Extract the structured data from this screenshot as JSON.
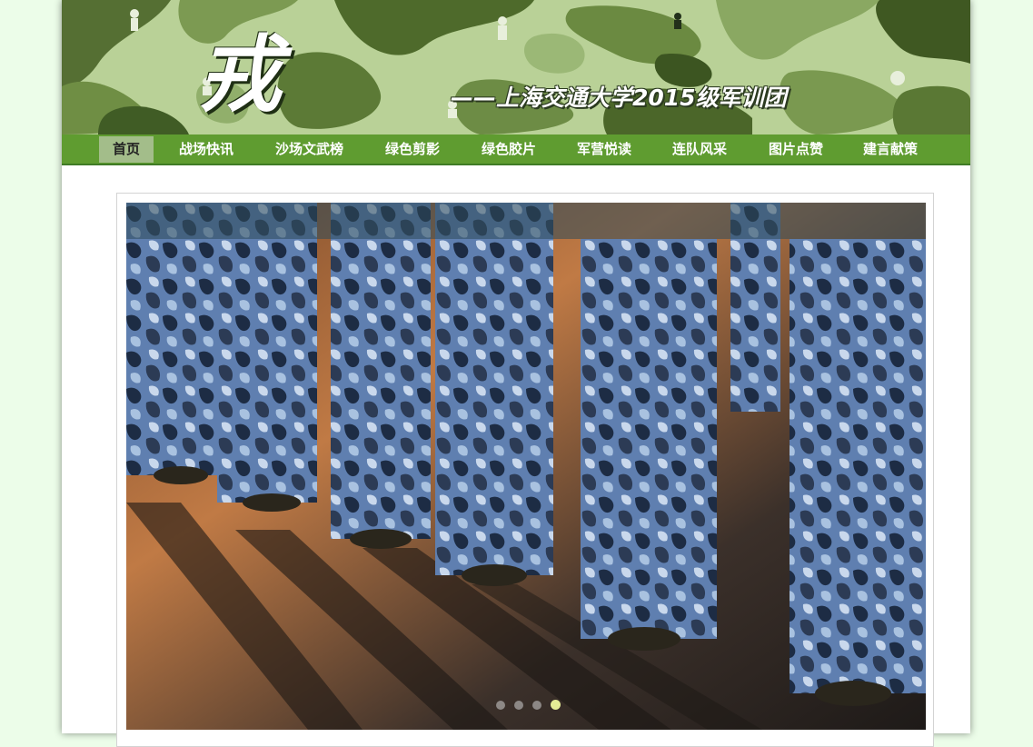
{
  "banner": {
    "logo_char": "戎",
    "subtitle": "——上海交通大学2015级军训团"
  },
  "nav": {
    "items": [
      {
        "label": "首页",
        "active": true
      },
      {
        "label": "战场快讯"
      },
      {
        "label": "沙场文武榜"
      },
      {
        "label": "绿色剪影"
      },
      {
        "label": "绿色胶片"
      },
      {
        "label": "军营悦读"
      },
      {
        "label": "连队风采"
      },
      {
        "label": "图片点赞"
      },
      {
        "label": "建言献策"
      }
    ]
  },
  "slider": {
    "slide_count": 4,
    "active_index": 3,
    "photo": "soldiers-camouflage-uniforms-standing-in-line"
  },
  "colors": {
    "page_background": "#ecfde9",
    "nav_green": "#5f9c30",
    "nav_active": "#a3bd8a",
    "dot_active": "#e5ec96"
  }
}
